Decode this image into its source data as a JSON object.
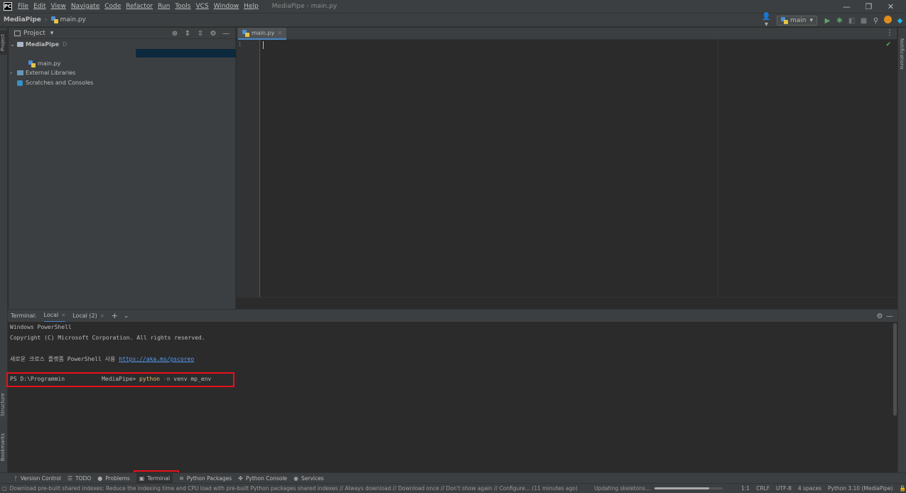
{
  "titlebar": {
    "logo": "PC",
    "menu": [
      "File",
      "Edit",
      "View",
      "Navigate",
      "Code",
      "Refactor",
      "Run",
      "Tools",
      "VCS",
      "Window",
      "Help"
    ],
    "window_title": "MediaPipe - main.py",
    "controls": {
      "minimize": "—",
      "restore": "❐",
      "close": "✕"
    }
  },
  "navbar": {
    "project": "MediaPipe",
    "file": "main.py",
    "run_config": "main",
    "icons": [
      "user-icon",
      "run-icon",
      "debug-icon",
      "coverage-icon",
      "stop-icon",
      "search-icon",
      "update-icon",
      "jetbrains-icon"
    ]
  },
  "left_strip": {
    "project_label": "Project",
    "structure_label": "Structure",
    "bookmarks_label": "Bookmarks"
  },
  "right_strip": {
    "notifications_label": "Notifications"
  },
  "project_panel": {
    "title": "Project",
    "root": {
      "name": "MediaPipe",
      "path_hint": "D"
    },
    "items": [
      {
        "label": "main.py",
        "icon": "python-file-icon"
      },
      {
        "label": "External Libraries",
        "icon": "library-icon"
      },
      {
        "label": "Scratches and Consoles",
        "icon": "scratch-icon"
      }
    ]
  },
  "editor": {
    "tab_label": "main.py",
    "line_numbers": [
      "1"
    ]
  },
  "terminal": {
    "label": "Terminal:",
    "tabs": [
      "Local",
      "Local (2)"
    ],
    "lines": {
      "l1": "Windows PowerShell",
      "l2": "Copyright (C) Microsoft Corporation. All rights reserved.",
      "l3_prefix": "새로운 크로스 플랫폼 PowerShell 사용 ",
      "l3_link": "https://aka.ms/pscoreo",
      "prompt_a": "PS D:\\Programmin",
      "prompt_b": "MediaPipe> ",
      "cmd": "python",
      "flag": "-m",
      "args": "venv mp_env"
    }
  },
  "bottom_tools": [
    {
      "label": "Version Control",
      "icon": "vcs-icon"
    },
    {
      "label": "TODO",
      "icon": "todo-icon"
    },
    {
      "label": "Problems",
      "icon": "problems-icon"
    },
    {
      "label": "Terminal",
      "icon": "terminal-icon"
    },
    {
      "label": "Python Packages",
      "icon": "packages-icon"
    },
    {
      "label": "Python Console",
      "icon": "python-console-icon"
    },
    {
      "label": "Services",
      "icon": "services-icon"
    }
  ],
  "statusbar": {
    "message": "Download pre-built shared indexes: Reduce the indexing time and CPU load with pre-built Python packages shared indexes // Always download // Download once // Don't show again // Configure... (11 minutes ago)",
    "progress_label": "Updating skeletons...",
    "progress_fraction": 0.8,
    "position": "1:1",
    "line_sep": "CRLF",
    "encoding": "UTF-8",
    "indent": "4 spaces",
    "interpreter": "Python 3.10 (MediaPipe)"
  },
  "colors": {
    "accent": "#4a88c7",
    "highlight": "#e8101a"
  }
}
